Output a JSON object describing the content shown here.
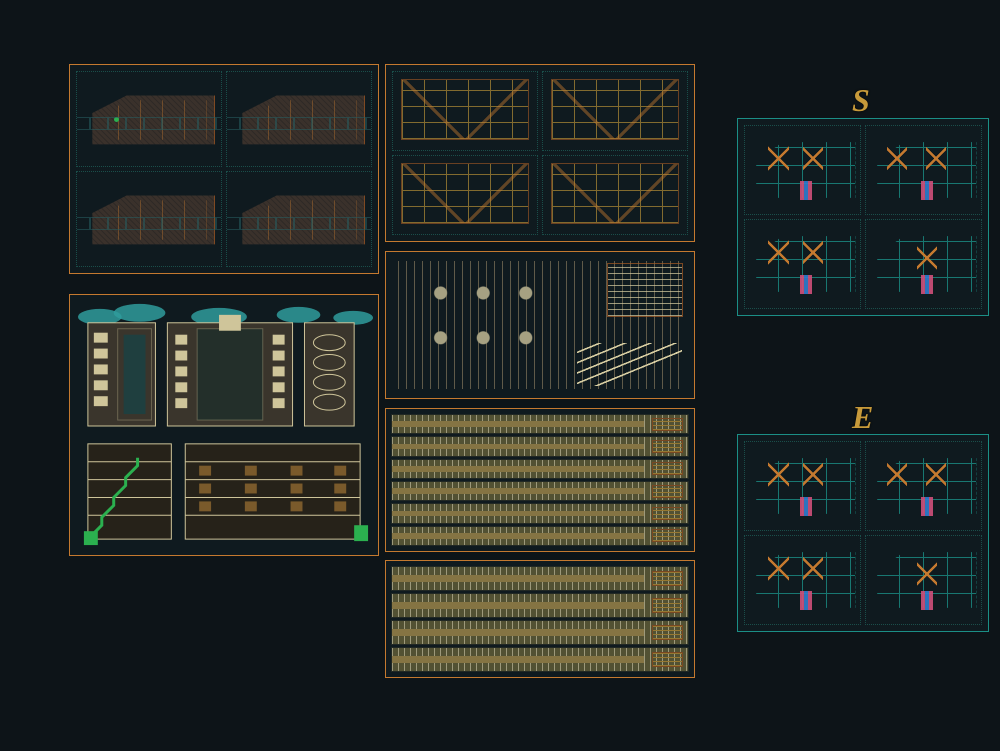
{
  "letters": {
    "s": "S",
    "e": "E"
  },
  "sheets": {
    "o1": {
      "kind": "floor-plans",
      "subplans": 4
    },
    "o2": {
      "kind": "structural-plans",
      "subplans": 4
    },
    "o3": {
      "kind": "elevations-sections",
      "subplans": 5
    },
    "o4": {
      "kind": "details",
      "subplans": 1
    },
    "o5": {
      "kind": "beam-schedule",
      "rows": 6
    },
    "o6": {
      "kind": "beam-schedule",
      "rows": 4
    },
    "t1": {
      "kind": "sanitary-plans",
      "subplans": 4
    },
    "t2": {
      "kind": "electrical-plans",
      "subplans": 4
    }
  }
}
